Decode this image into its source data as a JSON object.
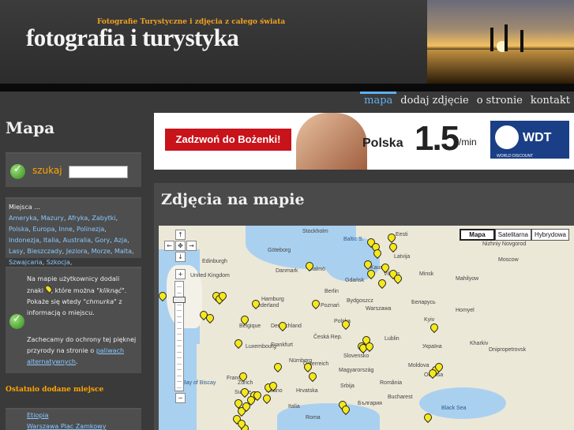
{
  "header": {
    "tagline": "Fotografie Turystyczne i zdjęcia z całego świata",
    "title": "fotografia i turystyka"
  },
  "nav": [
    {
      "label": "mapa",
      "active": true
    },
    {
      "label": "dodaj zdjęcie",
      "active": false
    },
    {
      "label": "o stronie",
      "active": false
    },
    {
      "label": "kontakt",
      "active": false
    }
  ],
  "sidebar": {
    "page_title": "Mapa",
    "search_label": "szukaj",
    "search_value": "",
    "places_heading": "Miejsca ...",
    "places": [
      "Ameryka",
      "Mazury",
      "Afryka",
      "Zabytki",
      "Polska",
      "Europa",
      "Inne",
      "Polinezja",
      "Indonezja",
      "Italia",
      "Australia",
      "Gory",
      "Azja",
      "Lasy",
      "Bieszczady",
      "Jeziora",
      "Morze",
      "Malta",
      "Szwajcaria",
      "Szkocja"
    ],
    "info_1_a": "Na mapie użytkownicy dodali znaki",
    "info_1_b": ", które można",
    "info_1_c": "\"kliknąć\"",
    "info_1_d": ". Pokaże się wtedy",
    "info_1_e": "\"chmurka\"",
    "info_1_f": "z informacją o miejscu.",
    "info_2_a": "Zachecamy do ochrony tej pięknej przyrody na stronie o",
    "info_2_link": "paliwach alternatywnych",
    "info_2_end": ".",
    "recent_heading": "Ostatnio dodane miejsce",
    "recent": [
      "Etiopia",
      "Warszawa Plac Zamkowy"
    ]
  },
  "banner": {
    "call": "Zadzwoń do Bożenki!",
    "country": "Polska",
    "rate": "1.5",
    "unit": "c/min",
    "logo": "WDT",
    "logo_sub": "WORLD DISCOUNT TELECOMMUNICATIONS"
  },
  "content": {
    "heading": "Zdjęcia na mapie"
  },
  "map": {
    "types": [
      {
        "label": "Mapa",
        "active": true
      },
      {
        "label": "Satelitarna",
        "active": false
      },
      {
        "label": "Hybrydowa",
        "active": false
      }
    ],
    "labels": [
      "Stockholm",
      "Eesti",
      "Latvija",
      "Nizhniy Novgorod",
      "Moscow",
      "Yaroslavl",
      "Göteborg",
      "Baltic S.",
      "Kaunas",
      "Vilnius",
      "Minsk",
      "Беларусь",
      "Mahilyow",
      "Homyel",
      "United Kingdom",
      "Edinburgh",
      "Danmark",
      "Malmö",
      "Gdańsk",
      "Hamburg",
      "Nederland",
      "Berlin",
      "Deutschland",
      "Polska",
      "Poznań",
      "Warszawa",
      "Bydgoszcz",
      "Lublin",
      "Kyiv",
      "Україна",
      "Kharkiv",
      "Dnipropetrovsk",
      "Belgique",
      "Luxembourg",
      "Frankfurt",
      "Nürnberg",
      "Česká Rep.",
      "Slovensko",
      "Österreich",
      "Magyarország",
      "Moldova",
      "France",
      "Zürich",
      "Suisse",
      "Hrvatska",
      "Srbija",
      "România",
      "Bucharest",
      "Odessa",
      "Italia",
      "България",
      "Black Sea",
      "Bay of Biscay",
      "Milano",
      "Roma"
    ]
  },
  "colors": {
    "accent_nav": "#5eb0f0",
    "sidebar_link": "#8ac8ff",
    "highlight": "#ffa500",
    "banner_red": "#c8131b"
  }
}
